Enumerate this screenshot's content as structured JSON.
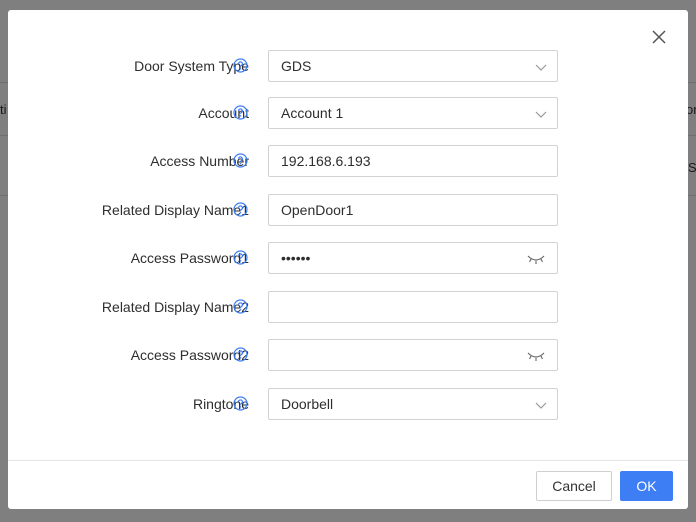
{
  "colors": {
    "accent": "#3d7ef5",
    "help_icon": "#3d7ef5",
    "text": "#2e2e2e",
    "border": "#d2d2d2"
  },
  "background": {
    "frag_left": "ti",
    "frag_right_top": "or",
    "frag_right_mid": "S"
  },
  "dialog": {
    "close_icon": "close-icon",
    "fields": [
      {
        "label": "Door System Type",
        "value": "GDS",
        "control": "select"
      },
      {
        "label": "Account",
        "value": "Account 1",
        "control": "select"
      },
      {
        "label": "Access Number",
        "value": "192.168.6.193",
        "control": "text"
      },
      {
        "label": "Related Display Name1",
        "value": "OpenDoor1",
        "control": "text"
      },
      {
        "label": "Access Password1",
        "value": "••••••",
        "control": "password"
      },
      {
        "label": "Related Display Name2",
        "value": "",
        "control": "text"
      },
      {
        "label": "Access Password2",
        "value": "",
        "control": "password"
      },
      {
        "label": "Ringtone",
        "value": "Doorbell",
        "control": "select"
      }
    ],
    "cancel_label": "Cancel",
    "ok_label": "OK"
  }
}
